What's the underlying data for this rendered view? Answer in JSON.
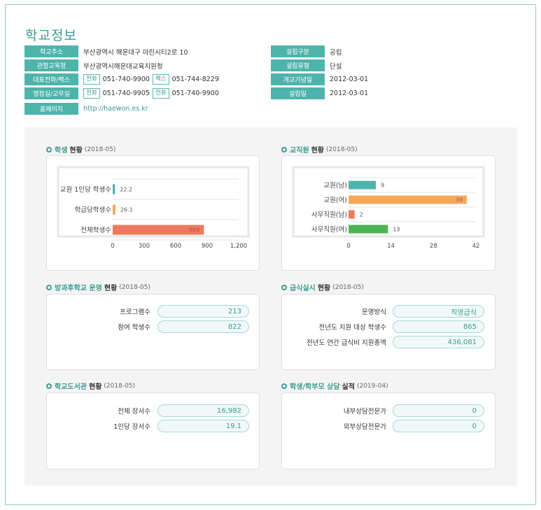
{
  "page_title": "학교정보",
  "info": {
    "address": {
      "label": "학교주소",
      "value": "부산광역시 해운대구 마린시티2로 10"
    },
    "office": {
      "label": "관할교육청",
      "value": "부산광역시해운대교육지원청"
    },
    "phone_fax": {
      "label": "대표전화/팩스",
      "tag1": "전화",
      "value1": "051-740-9900",
      "tag2": "팩스",
      "value2": "051-744-8229"
    },
    "admin": {
      "label": "행정실/교무실",
      "tag1": "전화",
      "value1": "051-740-9905",
      "tag2": "전화",
      "value2": "051-740-9900"
    },
    "homepage": {
      "label": "홈페이지",
      "value": "http://haewon.es.kr"
    },
    "establish_type": {
      "label": "설립구분",
      "value": "공립"
    },
    "establish_kind": {
      "label": "설립유형",
      "value": "단설"
    },
    "anniversary": {
      "label": "개교기념일",
      "value": "2012-03-01"
    },
    "establish_date": {
      "label": "설립일",
      "value": "2012-03-01"
    }
  },
  "sections": {
    "students": {
      "hl": "학생",
      "bold": "현황",
      "period": "(2018-05)"
    },
    "staff": {
      "hl": "교직원",
      "bold": "현황",
      "period": "(2018-05)"
    },
    "afterschool": {
      "hl": "방과후학교 운영",
      "bold": "현황",
      "period": "(2018-05)"
    },
    "meal": {
      "hl": "급식실시",
      "bold": "현황",
      "period": "(2018-05)"
    },
    "library": {
      "hl": "학교도서관",
      "bold": "현황",
      "period": "(2018-05)"
    },
    "counsel": {
      "hl": "학생/학부모 상담",
      "bold": "실적",
      "period": "(2019-04)"
    }
  },
  "afterschool": [
    {
      "label": "프로그램수",
      "value": "213"
    },
    {
      "label": "참여 학생수",
      "value": "822"
    }
  ],
  "meal": [
    {
      "label": "운영방식",
      "value": "직영급식"
    },
    {
      "label": "전년도 지원 대상 학생수",
      "value": "865"
    },
    {
      "label": "전년도 연간 급식비 지원총액",
      "value": "436,081"
    }
  ],
  "library": [
    {
      "label": "전체 장서수",
      "value": "16,982"
    },
    {
      "label": "1인당 장서수",
      "value": "19.1"
    }
  ],
  "counsel": [
    {
      "label": "내부상담전문가",
      "value": "0"
    },
    {
      "label": "외부상담전문가",
      "value": "0"
    }
  ],
  "chart_data": [
    {
      "type": "bar",
      "orientation": "horizontal",
      "categories": [
        "교원 1인당 학생수",
        "학급당학생수",
        "전체학생수"
      ],
      "values": [
        22.2,
        26.1,
        869
      ],
      "value_labels": [
        "22.2",
        "26.1",
        "869"
      ],
      "colors": [
        "#4db4ab",
        "#f5a85a",
        "#ee7a5e"
      ],
      "xlim": [
        0,
        1200
      ],
      "xticks": [
        "0",
        "300",
        "600",
        "900",
        "1,200"
      ],
      "xtick_values": [
        0,
        300,
        600,
        900,
        1200
      ],
      "grid": true
    },
    {
      "type": "bar",
      "orientation": "horizontal",
      "categories": [
        "교원(남)",
        "교원(여)",
        "사무직원(남)",
        "사무직원(여)"
      ],
      "values": [
        9,
        39,
        2,
        13
      ],
      "value_labels": [
        "9",
        "39",
        "2",
        "13"
      ],
      "colors": [
        "#4db4ab",
        "#f5a85a",
        "#ee7a5e",
        "#4cb552"
      ],
      "xlim": [
        0,
        42
      ],
      "xticks": [
        "0",
        "14",
        "28",
        "42"
      ],
      "xtick_values": [
        0,
        14,
        28,
        42
      ],
      "grid": true
    }
  ]
}
